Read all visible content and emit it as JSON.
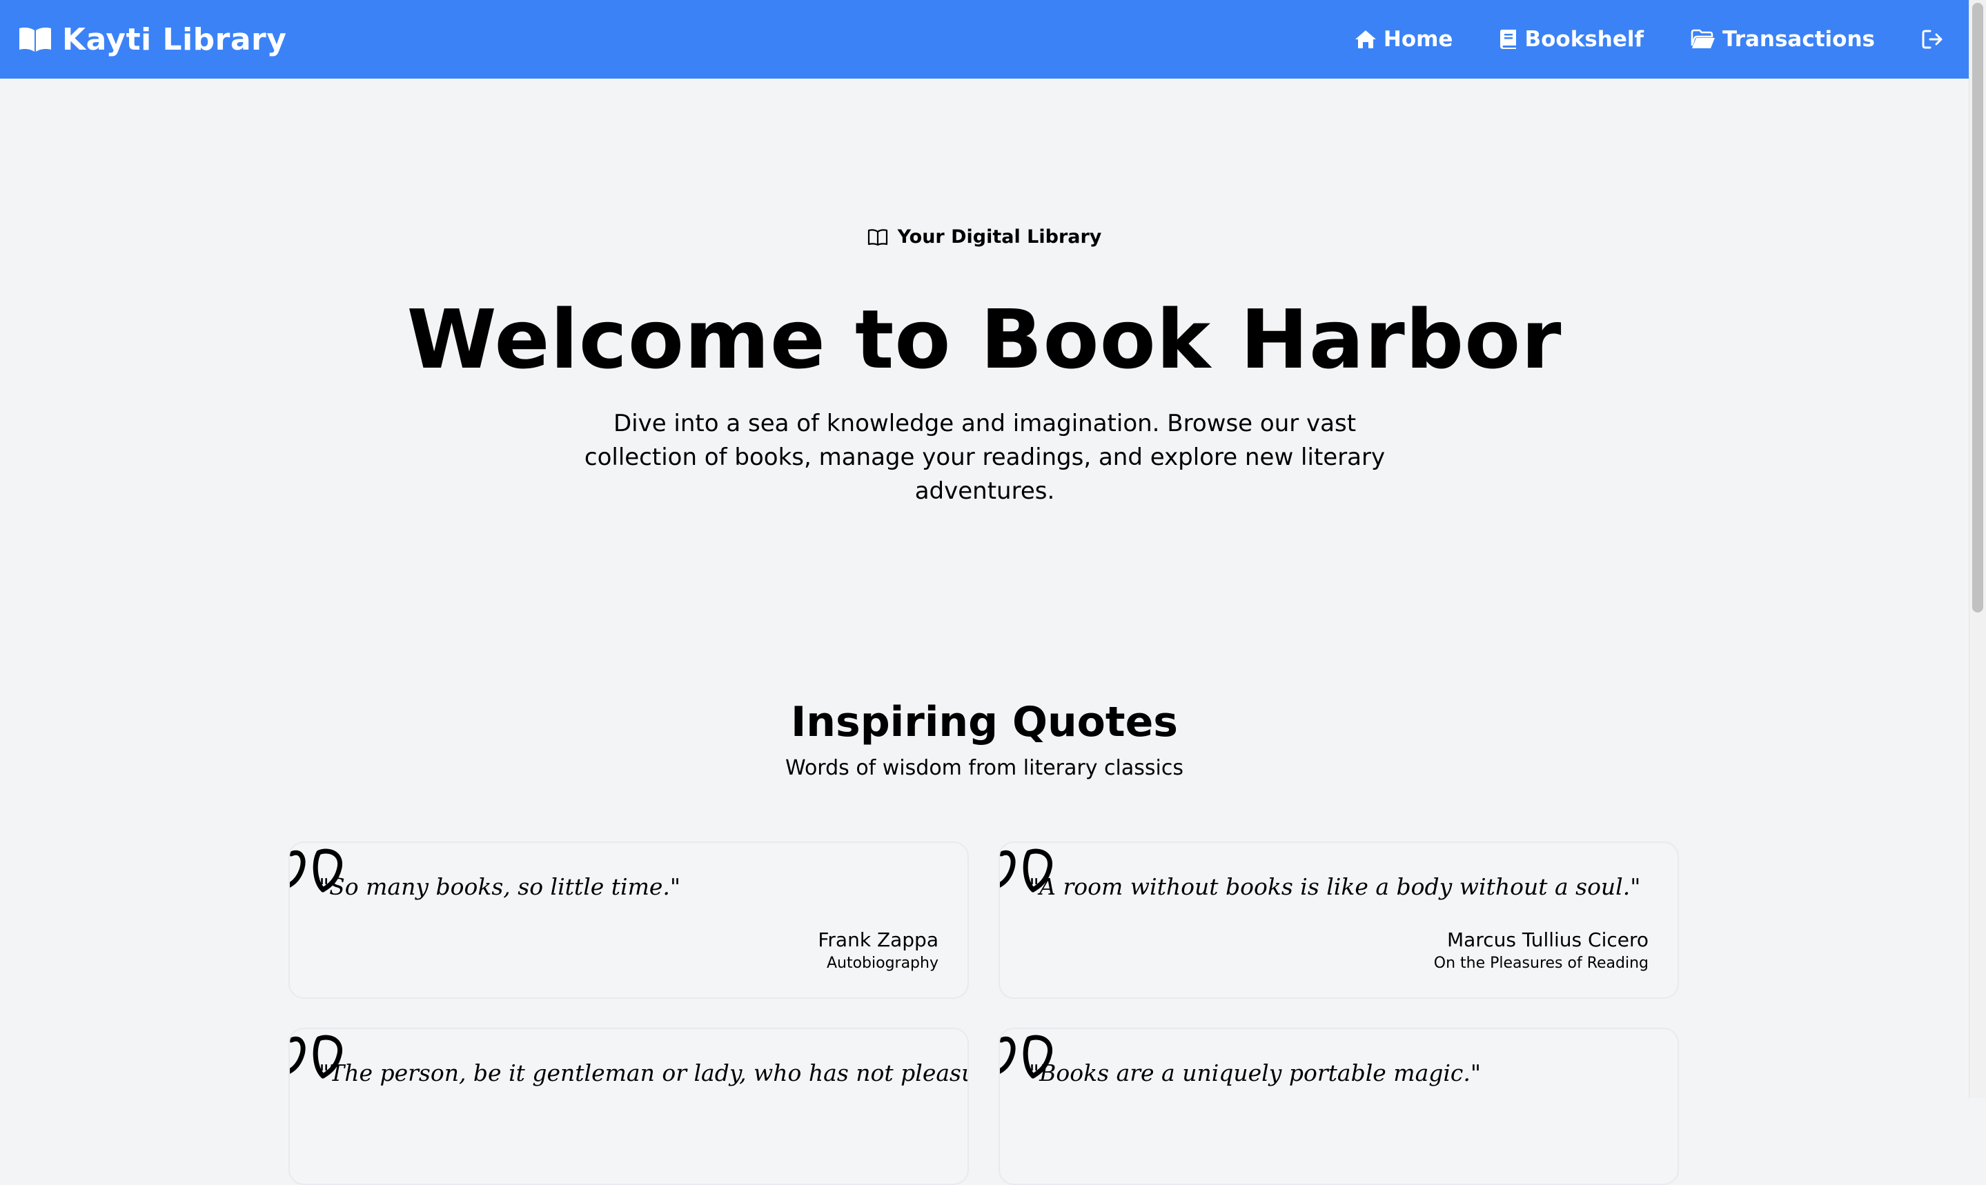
{
  "navbar": {
    "brand": "Kayti Library",
    "brand_icon": "book-open-icon",
    "links": [
      {
        "label": "Home",
        "icon": "home-icon"
      },
      {
        "label": "Bookshelf",
        "icon": "book-icon"
      },
      {
        "label": "Transactions",
        "icon": "folder-open-icon"
      }
    ],
    "logout_icon": "logout-icon",
    "color": "#3b82f6"
  },
  "hero": {
    "badge": "Your Digital Library",
    "badge_icon": "book-open-outline-icon",
    "title": "Welcome to Book Harbor",
    "description": "Dive into a sea of knowledge and imagination. Browse our vast collection of books, manage your readings, and explore new literary adventures."
  },
  "quotes_section": {
    "title": "Inspiring Quotes",
    "subtitle": "Words of wisdom from literary classics",
    "quotes": [
      {
        "text": "\"So many books, so little time.\"",
        "author": "Frank Zappa",
        "source": "Autobiography"
      },
      {
        "text": "\"A room without books is like a body without a soul.\"",
        "author": "Marcus Tullius Cicero",
        "source": "On the Pleasures of Reading"
      },
      {
        "text": "\"The person, be it gentleman or lady, who has not pleasure in a",
        "author": "",
        "source": ""
      },
      {
        "text": "\"Books are a uniquely portable magic.\"",
        "author": "",
        "source": ""
      }
    ]
  },
  "background_color": "#f3f4f6"
}
